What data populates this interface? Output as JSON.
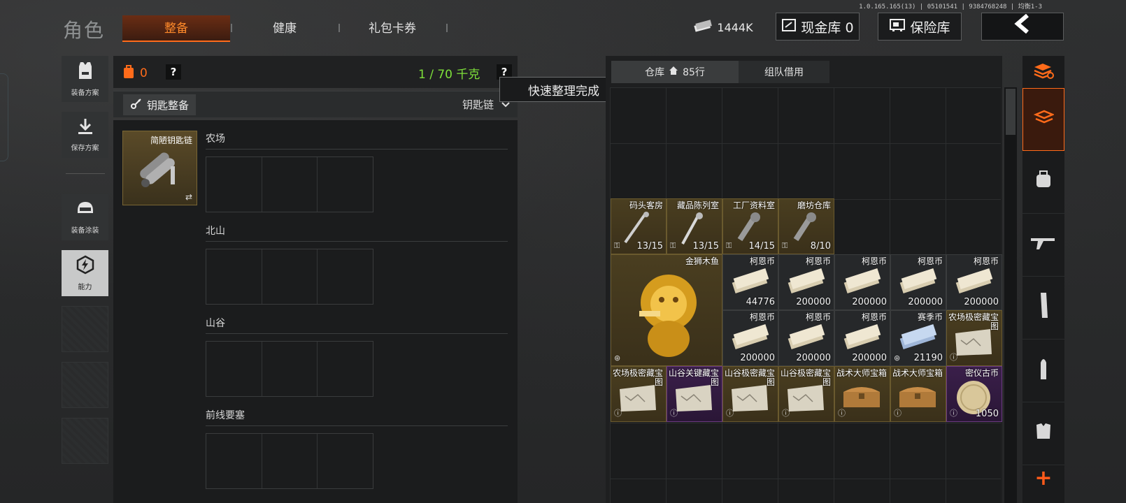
{
  "version": "1.0.165.165(13) | 05101541 | 9384768248 | 均衡1-3",
  "header": {
    "title": "角色",
    "tabs": [
      {
        "label": "整备",
        "active": true
      },
      {
        "label": "健康",
        "active": false
      },
      {
        "label": "礼包卡券",
        "active": false
      }
    ],
    "currency_amount": "1444K",
    "cash_vault_label": "现金库 0",
    "safe_label": "保险库",
    "back_icon": "chevron-left-icon"
  },
  "sidebar": {
    "items": [
      {
        "label": "装备方案",
        "icon": "vest-icon"
      },
      {
        "label": "保存方案",
        "icon": "download-icon"
      },
      {
        "label": "装备涂装",
        "icon": "helmet-icon"
      },
      {
        "label": "能力",
        "icon": "lightning-icon"
      }
    ]
  },
  "loadout": {
    "weight_badge": "0",
    "weight": "1 / 70 千克",
    "filter_label": "钥匙整备",
    "sort_label": "钥匙链",
    "toast": "快速整理完成",
    "keychain_name": "简陋钥匙链",
    "regions": [
      "农场",
      "北山",
      "山谷",
      "前线要塞"
    ]
  },
  "warehouse": {
    "tab_storage": "仓库",
    "storage_rows": "85行",
    "tab_team": "组队借用",
    "keys": [
      {
        "name": "码头客房",
        "qty": "13/15"
      },
      {
        "name": "藏品陈列室",
        "qty": "13/15"
      },
      {
        "name": "工厂资料室",
        "qty": "14/15"
      },
      {
        "name": "磨坊仓库",
        "qty": "8/10"
      }
    ],
    "lion": {
      "name": "金狮木鱼"
    },
    "coins_row1": [
      {
        "name": "柯恩币",
        "qty": "44776"
      },
      {
        "name": "柯恩币",
        "qty": "200000"
      },
      {
        "name": "柯恩币",
        "qty": "200000"
      },
      {
        "name": "柯恩币",
        "qty": "200000"
      },
      {
        "name": "柯恩币",
        "qty": "200000"
      }
    ],
    "coins_row2": [
      {
        "name": "柯恩币",
        "qty": "200000"
      },
      {
        "name": "柯恩币",
        "qty": "200000"
      },
      {
        "name": "柯恩币",
        "qty": "200000"
      },
      {
        "name": "赛季币",
        "qty": "21190"
      },
      {
        "name": "农场极密藏宝图",
        "qty": ""
      }
    ],
    "row3": [
      {
        "name": "农场极密藏宝图",
        "qty": ""
      },
      {
        "name": "山谷关键藏宝图",
        "qty": ""
      },
      {
        "name": "山谷极密藏宝图",
        "qty": ""
      },
      {
        "name": "山谷极密藏宝图",
        "qty": ""
      },
      {
        "name": "战术大师宝箱",
        "qty": ""
      },
      {
        "name": "战术大师宝箱",
        "qty": ""
      },
      {
        "name": "密仪古币",
        "qty": "1050"
      }
    ]
  },
  "categories": [
    "all-icon",
    "backpack-icon",
    "rifle-icon",
    "magazine-icon",
    "ammo-icon",
    "armor-icon"
  ],
  "accent_color": "#ff6b1a"
}
